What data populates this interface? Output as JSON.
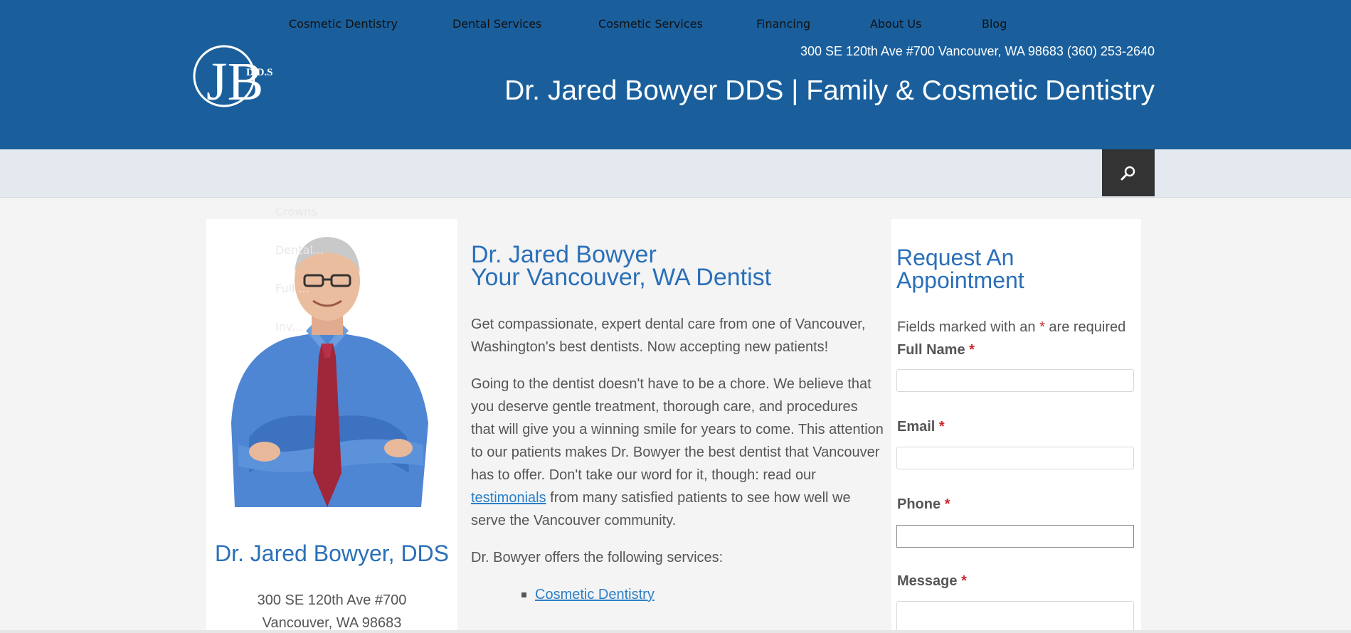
{
  "header": {
    "logo_text": "JB",
    "logo_suffix": "D.D.S",
    "address_line": "300 SE 120th Ave #700 Vancouver, WA 98683 (360) 253-2640",
    "site_title": "Dr. Jared Bowyer DDS | Family & Cosmetic Dentistry"
  },
  "nav": {
    "items": [
      {
        "label": "Cosmetic Dentistry"
      },
      {
        "label": "Dental Services"
      },
      {
        "label": "Cosmetic Services"
      },
      {
        "label": "Financing"
      },
      {
        "label": "About Us"
      },
      {
        "label": "Blog"
      }
    ],
    "search_icon": "search-icon"
  },
  "ghost_menu": [
    "Crowns",
    "Dental...",
    "Full ...",
    "Inv..."
  ],
  "profile": {
    "name": "Dr. Jared Bowyer, DDS",
    "address_line1": "300 SE 120th Ave #700",
    "address_line2": "Vancouver, WA 98683"
  },
  "main": {
    "heading_line1": "Dr. Jared Bowyer",
    "heading_line2": "Your Vancouver, WA Dentist",
    "intro": "Get compassionate, expert dental care from one of Vancouver, Washington's best dentists. Now accepting new patients!",
    "para2_before": "Going to the dentist doesn't have to be a chore. We believe that you deserve gentle treatment, thorough care, and procedures that will give you a winning smile for years to come. This attention to our patients makes Dr. Bowyer the best dentist that Vancouver has to offer. Don't take our word for it, though: read our ",
    "para2_link": "testimonials",
    "para2_after": " from many satisfied patients to see how well we serve the Vancouver community.",
    "services_intro": "Dr. Bowyer offers the following services:",
    "services": [
      "Cosmetic Dentistry"
    ]
  },
  "form": {
    "title_line1": "Request An",
    "title_line2": "Appointment",
    "required_prefix": "Fields marked with an ",
    "required_star": "*",
    "required_suffix": " are required",
    "fields": [
      {
        "label": "Full Name",
        "star": "*"
      },
      {
        "label": "Email",
        "star": "*"
      },
      {
        "label": "Phone",
        "star": "*"
      },
      {
        "label": "Message",
        "star": "*"
      }
    ]
  },
  "colors": {
    "header_bg": "#1a5f9c",
    "nav_bg": "#e4e9ef",
    "accent_blue": "#2a6fb8",
    "required_red": "#d0262b"
  }
}
